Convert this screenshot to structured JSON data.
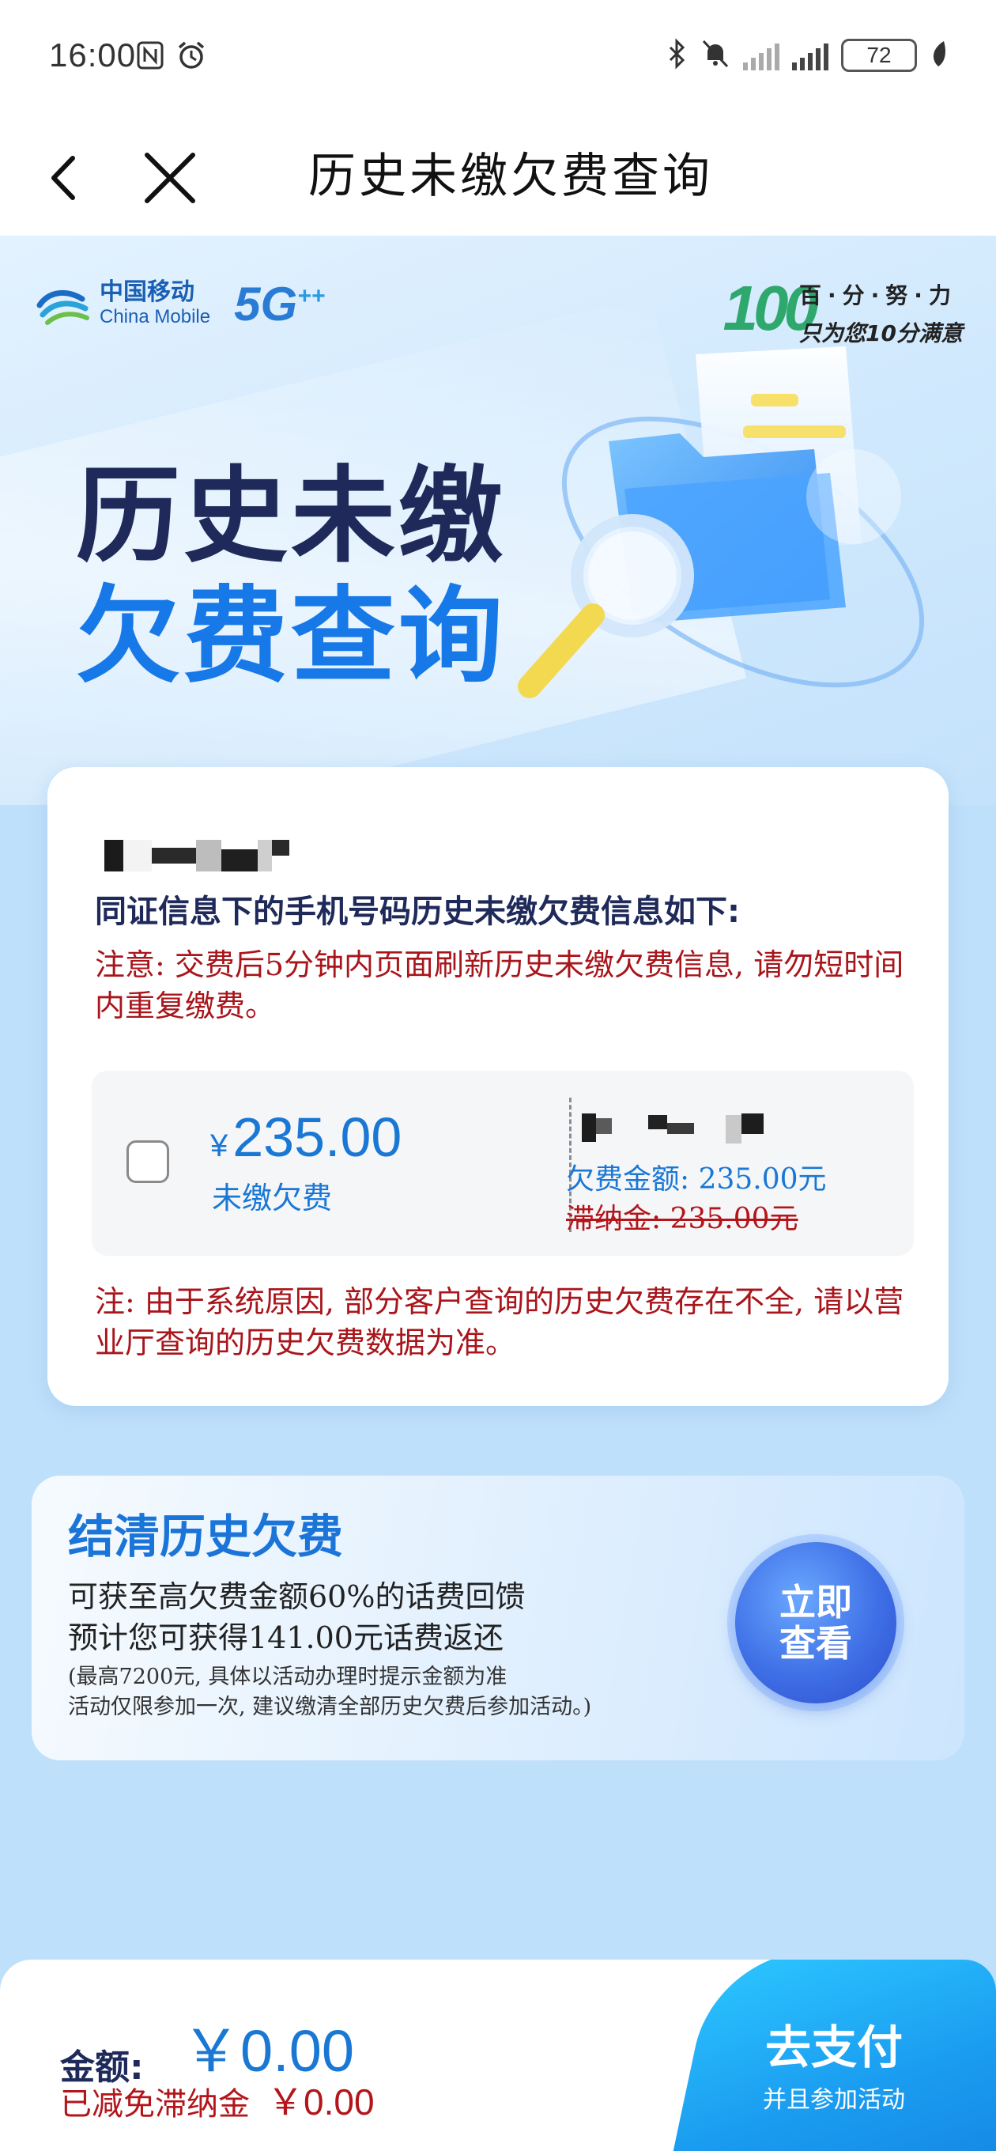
{
  "status_bar": {
    "time": "16:00",
    "battery": "72"
  },
  "nav": {
    "title": "历史未缴欠费查询"
  },
  "hero": {
    "brand_cn": "中国移动",
    "brand_en": "China Mobile",
    "network": "5G",
    "network_plus": "++",
    "badge": "100",
    "slogan_line1": "百·分·努·力",
    "slogan_line2": "只为您10分满意",
    "title_line1": "历史未缴",
    "title_line2": "欠费查询"
  },
  "card": {
    "heading": "同证信息下的手机号码历史未缴欠费信息如下:",
    "notice": "注意: 交费后5分钟内页面刷新历史未缴欠费信息, 请勿短时间内重复缴费。",
    "bill": {
      "currency": "¥",
      "amount": "235.00",
      "amount_label": "未缴欠费",
      "fee_line": "欠费金额: 235.00元",
      "late_fee_line": "滞纳金: 235.00元"
    },
    "footnote": "注: 由于系统原因, 部分客户查询的历史欠费存在不全, 请以营业厅查询的历史欠费数据为准。"
  },
  "promo": {
    "title": "结清历史欠费",
    "line1": "可获至高欠费金额60%的话费回馈",
    "line2": "预计您可获得141.00元话费返还",
    "note1": "(最高7200元, 具体以活动办理时提示金额为准",
    "note2": "活动仅限参加一次, 建议缴清全部历史欠费后参加活动。)",
    "cta": "立即查看"
  },
  "bottom": {
    "amount_label": "金额:",
    "amount_value": "￥0.00",
    "discount_label": "已减免滞纳金",
    "discount_value": "￥0.00",
    "pay_label": "去支付",
    "pay_sub": "并且参加活动"
  },
  "colors": {
    "brand_blue": "#1a78d4",
    "warning_red": "#a8151b",
    "pay_button": "#1a9cf0"
  }
}
